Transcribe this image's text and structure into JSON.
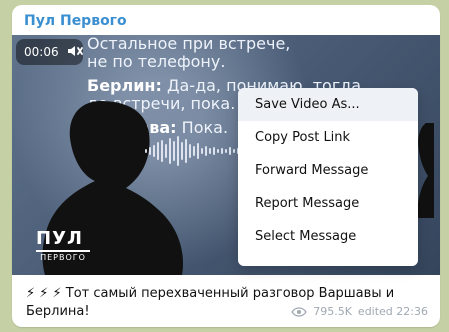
{
  "header": {
    "channel": "Пул Первого"
  },
  "video": {
    "time": "00:06",
    "caption": {
      "line1": "Остальное при встрече,",
      "line2": "не по телефону.",
      "berlin_label": "Берлин:",
      "berlin_text_1": "Да-да, понимаю, тогда",
      "berlin_text_2": "до встречи, пока.",
      "warsaw_label": "Варшава:",
      "warsaw_text": "Пока."
    },
    "logo": {
      "top": "ПУЛ",
      "bottom": "ПЕРВОГО"
    }
  },
  "menu": {
    "items": [
      "Save Video As...",
      "Copy Post Link",
      "Forward Message",
      "Report Message",
      "Select Message"
    ]
  },
  "message": {
    "text": "⚡ ⚡ ⚡ Тот самый перехваченный разговор Варшавы и Берлина!",
    "views": "795.5K",
    "edited": "edited 22:36"
  }
}
